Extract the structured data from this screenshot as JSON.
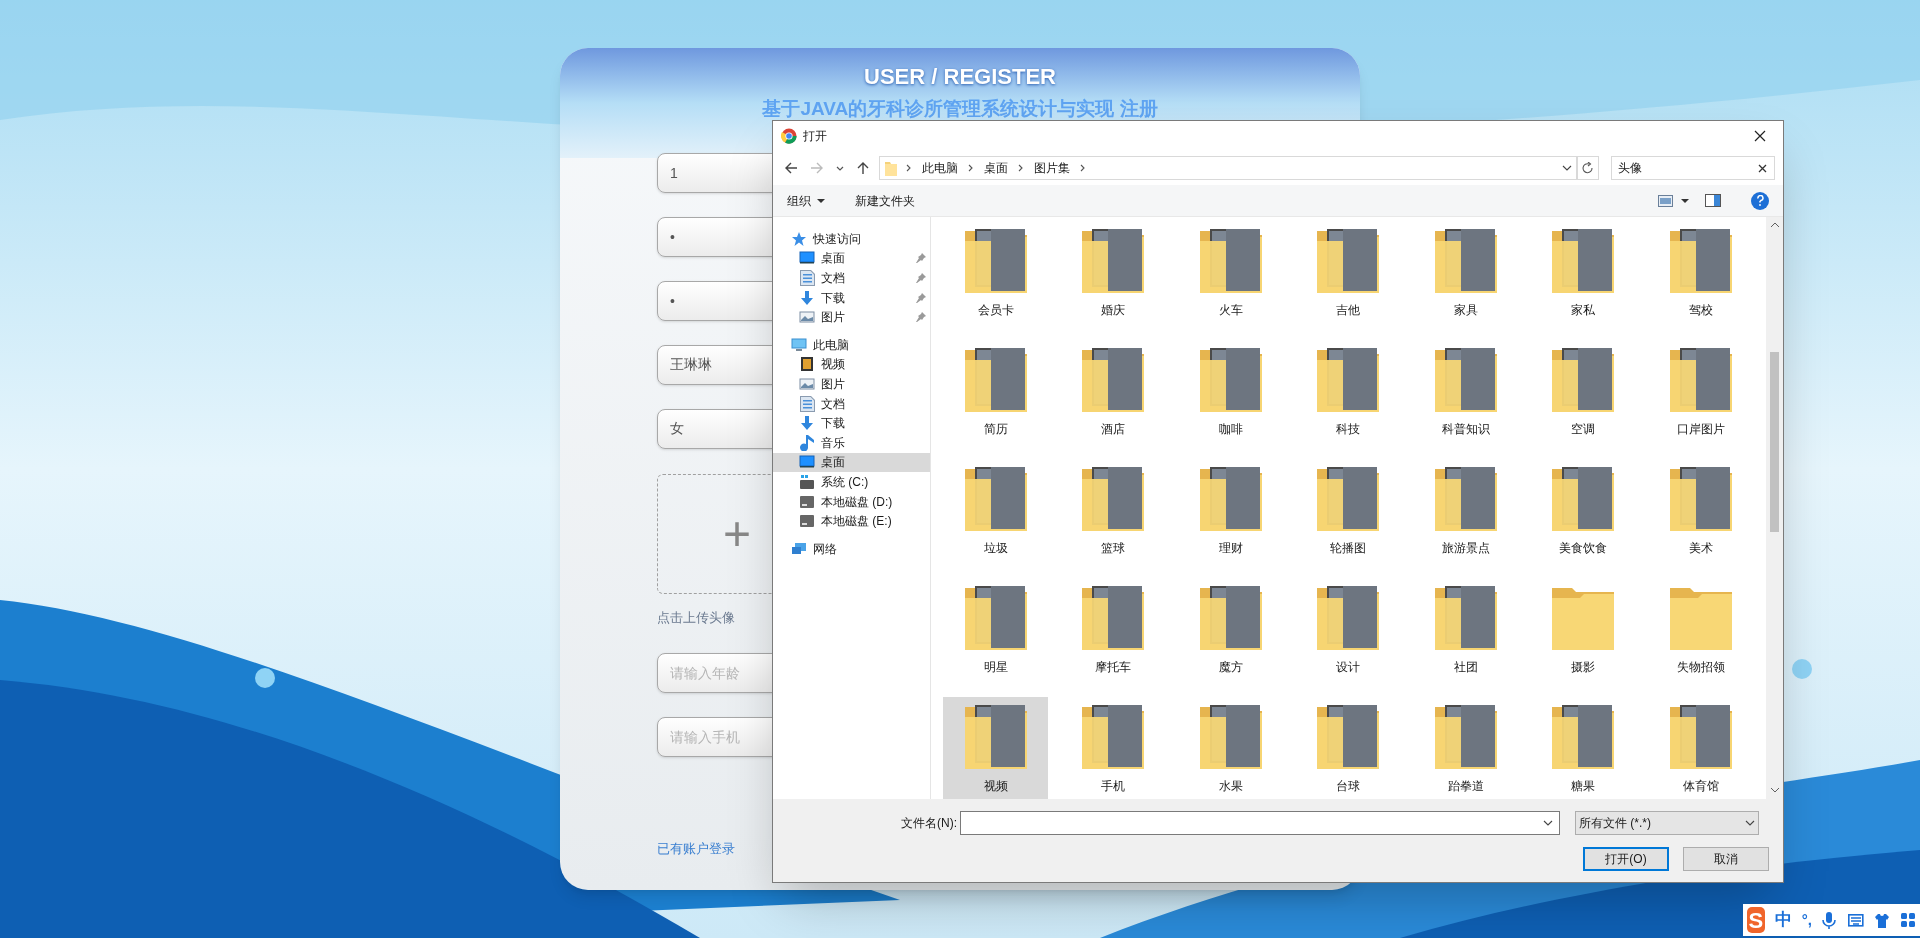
{
  "register": {
    "title": "USER / REGISTER",
    "subtitle": "基于JAVA的牙科诊所管理系统设计与实现 注册",
    "fields_top": [
      {
        "value": "1"
      },
      {
        "value": "•"
      },
      {
        "value": "•"
      },
      {
        "value": "王琳琳"
      },
      {
        "value": "女"
      }
    ],
    "upload": {
      "icon": "+",
      "caption": "点击上传头像"
    },
    "fields_bottom": [
      {
        "placeholder": "请输入年龄"
      },
      {
        "placeholder": "请输入手机"
      }
    ],
    "login_link": "已有账户登录"
  },
  "dialog": {
    "title": "打开",
    "breadcrumb": [
      "此电脑",
      "桌面",
      "图片集"
    ],
    "search": {
      "value": "头像"
    },
    "toolbar": {
      "organize": "组织",
      "new_folder": "新建文件夹"
    },
    "nav": [
      {
        "label": "快速访问",
        "kind": "star",
        "selected": false,
        "children": [
          {
            "label": "桌面",
            "kind": "desktop",
            "pinned": true,
            "selected": false
          },
          {
            "label": "文档",
            "kind": "document",
            "pinned": true,
            "selected": false
          },
          {
            "label": "下载",
            "kind": "download",
            "pinned": true,
            "selected": false
          },
          {
            "label": "图片",
            "kind": "picture",
            "pinned": true,
            "selected": false
          }
        ]
      },
      {
        "label": "此电脑",
        "kind": "pc",
        "selected": false,
        "children": [
          {
            "label": "视频",
            "kind": "video",
            "pinned": false,
            "selected": false
          },
          {
            "label": "图片",
            "kind": "picture",
            "pinned": false,
            "selected": false
          },
          {
            "label": "文档",
            "kind": "document",
            "pinned": false,
            "selected": false
          },
          {
            "label": "下载",
            "kind": "download",
            "pinned": false,
            "selected": false
          },
          {
            "label": "音乐",
            "kind": "music",
            "pinned": false,
            "selected": false
          },
          {
            "label": "桌面",
            "kind": "desktop",
            "pinned": false,
            "selected": true
          },
          {
            "label": "系统 (C:)",
            "kind": "system",
            "pinned": false,
            "selected": false
          },
          {
            "label": "本地磁盘 (D:)",
            "kind": "drive",
            "pinned": false,
            "selected": false
          },
          {
            "label": "本地磁盘 (E:)",
            "kind": "drive",
            "pinned": false,
            "selected": false
          }
        ]
      },
      {
        "label": "网络",
        "kind": "network",
        "selected": false
      }
    ],
    "folders": [
      {
        "name": "会员卡",
        "preview": true,
        "selected": false
      },
      {
        "name": "婚庆",
        "preview": true,
        "selected": false
      },
      {
        "name": "火车",
        "preview": true,
        "selected": false
      },
      {
        "name": "吉他",
        "preview": true,
        "selected": false
      },
      {
        "name": "家具",
        "preview": true,
        "selected": false
      },
      {
        "name": "家私",
        "preview": true,
        "selected": false
      },
      {
        "name": "驾校",
        "preview": true,
        "selected": false
      },
      {
        "name": "简历",
        "preview": true,
        "selected": false
      },
      {
        "name": "酒店",
        "preview": true,
        "selected": false
      },
      {
        "name": "咖啡",
        "preview": true,
        "selected": false
      },
      {
        "name": "科技",
        "preview": true,
        "selected": false
      },
      {
        "name": "科普知识",
        "preview": true,
        "selected": false
      },
      {
        "name": "空调",
        "preview": true,
        "selected": false
      },
      {
        "name": "口岸图片",
        "preview": true,
        "selected": false
      },
      {
        "name": "垃圾",
        "preview": true,
        "selected": false
      },
      {
        "name": "篮球",
        "preview": true,
        "selected": false
      },
      {
        "name": "理财",
        "preview": true,
        "selected": false
      },
      {
        "name": "轮播图",
        "preview": true,
        "selected": false
      },
      {
        "name": "旅游景点",
        "preview": true,
        "selected": false
      },
      {
        "name": "美食饮食",
        "preview": true,
        "selected": false
      },
      {
        "name": "美术",
        "preview": true,
        "selected": false
      },
      {
        "name": "明星",
        "preview": true,
        "selected": false
      },
      {
        "name": "摩托车",
        "preview": true,
        "selected": false
      },
      {
        "name": "魔方",
        "preview": true,
        "selected": false
      },
      {
        "name": "设计",
        "preview": true,
        "selected": false
      },
      {
        "name": "社团",
        "preview": true,
        "selected": false
      },
      {
        "name": "摄影",
        "preview": false,
        "selected": false
      },
      {
        "name": "失物招领",
        "preview": false,
        "selected": false
      },
      {
        "name": "视频",
        "preview": true,
        "selected": true
      },
      {
        "name": "手机",
        "preview": true,
        "selected": false
      },
      {
        "name": "水果",
        "preview": true,
        "selected": false
      },
      {
        "name": "台球",
        "preview": true,
        "selected": false
      },
      {
        "name": "跆拳道",
        "preview": true,
        "selected": false
      },
      {
        "name": "糖果",
        "preview": true,
        "selected": false
      },
      {
        "name": "体育馆",
        "preview": true,
        "selected": false
      }
    ],
    "filename_label": "文件名(N):",
    "filter": "所有文件 (*.*)",
    "buttons": [
      {
        "label": "打开(O)",
        "default": true
      },
      {
        "label": "取消",
        "default": false
      }
    ]
  },
  "ime_bar": {
    "logo": "S",
    "mode": "中",
    "punctuation": "°,"
  }
}
